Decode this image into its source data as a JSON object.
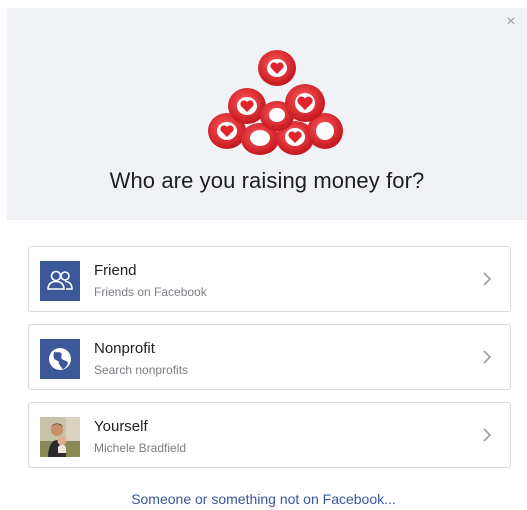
{
  "dialog": {
    "close_glyph": "×",
    "title": "Who are you raising money for?"
  },
  "options": [
    {
      "label": "Friend",
      "sub": "Friends on Facebook",
      "icon": "friends-icon"
    },
    {
      "label": "Nonprofit",
      "sub": "Search nonprofits",
      "icon": "globe-icon"
    },
    {
      "label": "Yourself",
      "sub": "Michele Bradfield",
      "icon": "avatar"
    }
  ],
  "footer": {
    "link": "Someone or something not on Facebook..."
  },
  "colors": {
    "brand_blue": "#3b5998",
    "link_blue": "#385898",
    "hero_red": "#e0242c",
    "header_bg": "#f1f2f6"
  }
}
